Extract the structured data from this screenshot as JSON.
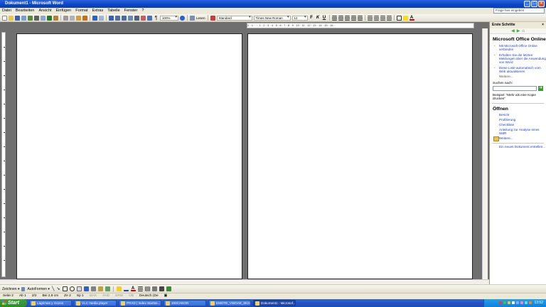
{
  "window": {
    "title": "Dokument1 - Microsoft Word"
  },
  "menu": {
    "items": [
      "Datei",
      "Bearbeiten",
      "Ansicht",
      "Einfügen",
      "Format",
      "Extras",
      "Tabelle",
      "Fenster",
      "?"
    ],
    "help_placeholder": "Frage hier eingeben"
  },
  "toolbar": {
    "zoom": "100%",
    "read_label": "Lesen",
    "style": "Standard",
    "font": "Times New Roman",
    "size": "12"
  },
  "ruler": {
    "ticks": "2 · 1 · · · 1 · 2 · 3 · 4 · 5 · 6 · 7 · 8 · 9 · 10 · 11 · 12 · 13 · 14 · 15 · 16 ·"
  },
  "task_pane": {
    "title": "Erste Schritte",
    "section1_heading": "Microsoft Office Online",
    "links": [
      "Mit Microsoft Office Online verbinden",
      "Erhalten Sie die letzten Meldungen über die Anwendung von Word",
      "Diese Liste automatisch vom Web aktualisieren"
    ],
    "more": "Weitere...",
    "search_label": "Suchen nach:",
    "example": "Beispiel: \"Mehr als eine Kopie drucken\"",
    "open_heading": "Öffnen",
    "open_items": [
      "Bericht",
      "Profilierung",
      "Checkliste",
      "Anleitung zur Analyse eines NMR"
    ],
    "open_more": "Weitere...",
    "new_doc": "Ein neues Dokument erstellen..."
  },
  "drawbar": {
    "draw": "Zeichnen ▾",
    "autoshapes": "AutoFormen ▾"
  },
  "status": {
    "page": "Seite 2",
    "section": "Ab 1",
    "pages": "2/2",
    "at": "Bei 2,9 cm",
    "line": "Ze 2",
    "col": "Sp 1",
    "flags": [
      "MAK",
      "ÄND",
      "ERW",
      "ÜB"
    ],
    "language": "Deutsch (De"
  },
  "taskbar": {
    "start": "Start",
    "tasks": [
      "Lágrimas y Gozos",
      "VLC media player",
      "PRAD | Index Startse...",
      "100CANON",
      "EMOTE_VWOAE_0K24...",
      "Dokument1 - Microsof..."
    ],
    "active_index": 5,
    "clock": "13:52"
  }
}
